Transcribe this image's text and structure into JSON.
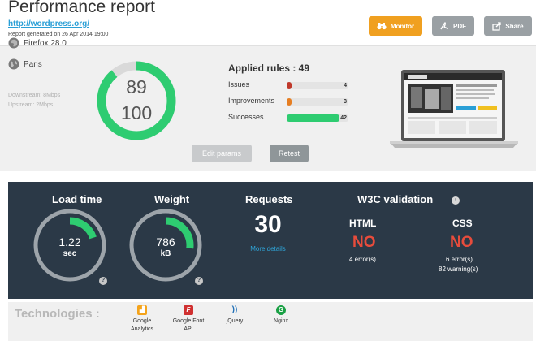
{
  "header": {
    "title": "Performance report",
    "url": "http://wordpress.org/",
    "generated": "Report generated on 26 Apr 2014 19:00",
    "buttons": {
      "monitor": "Monitor",
      "pdf": "PDF",
      "share": "Share"
    }
  },
  "summary": {
    "browser": "Firefox 28.0",
    "location": "Paris",
    "downstream": "Downstream: 8Mbps",
    "upstream": "Upstream: 2Mbps",
    "score": "89",
    "score_max": "100",
    "score_fraction": 0.89,
    "applied_rules": "Applied rules : 49",
    "rules": [
      {
        "label": "Issues",
        "count": "4",
        "fraction": 0.08,
        "color": "#c0392b"
      },
      {
        "label": "Improvements",
        "count": "3",
        "fraction": 0.06,
        "color": "#e67e22"
      },
      {
        "label": "Successes",
        "count": "42",
        "fraction": 0.86,
        "color": "#2ecc71"
      }
    ],
    "edit_label": "Edit params",
    "retest_label": "Retest"
  },
  "metrics": {
    "load_time": {
      "title": "Load time",
      "value": "1.22",
      "unit": "sec",
      "fraction": 0.2
    },
    "weight": {
      "title": "Weight",
      "value": "786",
      "unit": "kB",
      "fraction": 0.27
    },
    "requests": {
      "title": "Requests",
      "value": "30",
      "link": "More details"
    },
    "w3c": {
      "title": "W3C validation",
      "html": {
        "label": "HTML",
        "status": "NO",
        "errors": "4 error(s)"
      },
      "css": {
        "label": "CSS",
        "status": "NO",
        "errors": "6 error(s)",
        "warnings": "82 warning(s)"
      }
    }
  },
  "technologies": {
    "title": "Technologies :",
    "items": [
      {
        "name": "Google Analytics",
        "line1": "Google",
        "line2": "Analytics",
        "icon": "google-analytics-icon",
        "color": "#f4a31b"
      },
      {
        "name": "Google Font API",
        "line1": "Google Font",
        "line2": "API",
        "icon": "google-font-api-icon",
        "color": "#d03030"
      },
      {
        "name": "jQuery",
        "line1": "jQuery",
        "line2": "",
        "icon": "jquery-icon",
        "color": "#1f6fb7"
      },
      {
        "name": "Nginx",
        "line1": "Nginx",
        "line2": "",
        "icon": "nginx-icon",
        "color": "#19a044"
      }
    ]
  }
}
